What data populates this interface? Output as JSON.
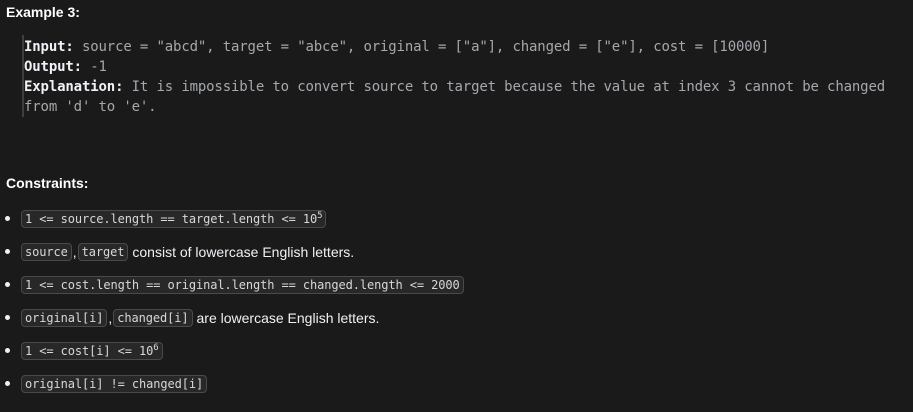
{
  "example": {
    "heading": "Example 3:",
    "input_label": "Input:",
    "input_value": "source = \"abcd\", target = \"abce\", original = [\"a\"], changed = [\"e\"], cost = [10000]",
    "output_label": "Output:",
    "output_value": "-1",
    "explanation_label": "Explanation:",
    "explanation_line1": "It is impossible to convert source to target because the value at index 3 cannot be changed",
    "explanation_line2": "from 'd' to 'e'."
  },
  "constraints": {
    "heading": "Constraints:",
    "c1_code": "1 <= source.length == target.length <= 10",
    "c1_sup": "5",
    "c2_code_a": "source",
    "c2_sep": ",",
    "c2_code_b": "target",
    "c2_text": "consist of lowercase English letters.",
    "c3_code": "1 <= cost.length == original.length == changed.length <= 2000",
    "c4_code_a": "original[i]",
    "c4_sep": ",",
    "c4_code_b": "changed[i]",
    "c4_text": "are lowercase English letters.",
    "c5_code": "1 <= cost[i] <= 10",
    "c5_sup": "6",
    "c6_code": "original[i] != changed[i]"
  }
}
